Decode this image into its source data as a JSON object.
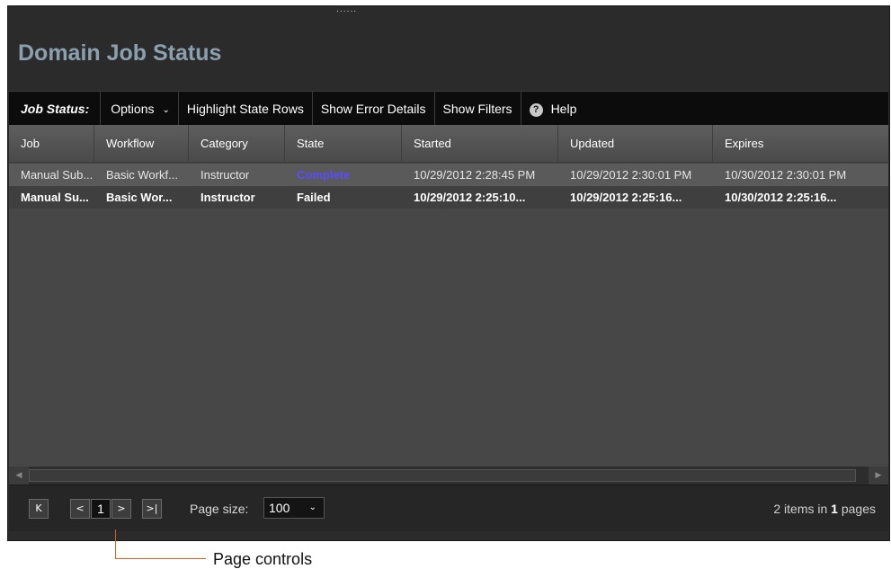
{
  "panel": {
    "title": "Domain Job Status",
    "grip": "......"
  },
  "toolbar": {
    "label": "Job Status:",
    "options": "Options",
    "highlight": "Highlight State Rows",
    "error_details": "Show Error Details",
    "filters": "Show Filters",
    "help": "Help"
  },
  "grid": {
    "columns": [
      "Job",
      "Workflow",
      "Category",
      "State",
      "Started",
      "Updated",
      "Expires"
    ],
    "rows": [
      [
        "Manual Sub...",
        "Basic Workf...",
        "Instructor",
        "Complete",
        "10/29/2012 2:28:45 PM",
        "10/29/2012 2:30:01 PM",
        "10/30/2012 2:30:01 PM"
      ],
      [
        "Manual Su...",
        "Basic Wor...",
        "Instructor",
        "Failed",
        "10/29/2012 2:25:10...",
        "10/29/2012 2:25:16...",
        "10/30/2012 2:25:16..."
      ]
    ]
  },
  "pager": {
    "first": "K",
    "prev": "<",
    "page": "1",
    "next": ">",
    "last": ">|",
    "page_size_label": "Page size:",
    "page_size_value": "100",
    "items_count": "2",
    "items_text": " items in ",
    "pages_count": "1",
    "pages_text": " pages"
  },
  "annotation": {
    "label": "Page controls"
  },
  "colors": {
    "accent_complete": "#5a4cff",
    "callout": "#d0611e",
    "title": "#8aa0ae"
  },
  "icons": {
    "help": "question-circle-icon",
    "dropdown": "chevron-down-icon"
  }
}
